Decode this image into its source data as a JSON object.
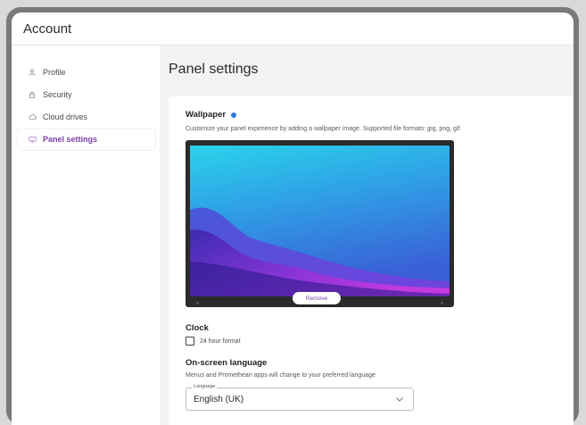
{
  "window": {
    "title": "Account"
  },
  "sidebar": {
    "items": [
      {
        "label": "Profile",
        "icon": "person-icon",
        "active": false
      },
      {
        "label": "Security",
        "icon": "lock-icon",
        "active": false
      },
      {
        "label": "Cloud drives",
        "icon": "cloud-icon",
        "active": false
      },
      {
        "label": "Panel settings",
        "icon": "panel-icon",
        "active": true
      }
    ]
  },
  "main": {
    "page_title": "Panel settings",
    "wallpaper": {
      "title": "Wallpaper",
      "description": "Customize your panel experience by adding a wallpaper image. Supported file formats: jpg, png, gif",
      "remove_label": "Remove"
    },
    "clock": {
      "title": "Clock",
      "checkbox_label": "24 hour format",
      "checked": false
    },
    "language": {
      "title": "On-screen language",
      "description": "Menus and Promethean apps will change to your preferred language",
      "field_label": "Language",
      "selected": "English (UK)"
    }
  },
  "colors": {
    "accent": "#7b3fa8",
    "info_dot": "#2f78d8",
    "background": "#f3f3f3"
  }
}
